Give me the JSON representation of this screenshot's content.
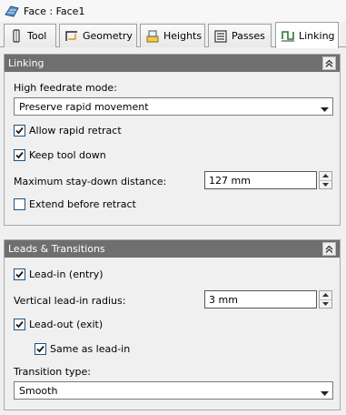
{
  "window": {
    "title": "Face : Face1"
  },
  "tabs": [
    {
      "label": "Tool",
      "icon": "tool-icon"
    },
    {
      "label": "Geometry",
      "icon": "geometry-icon"
    },
    {
      "label": "Heights",
      "icon": "heights-icon"
    },
    {
      "label": "Passes",
      "icon": "passes-icon"
    },
    {
      "label": "Linking",
      "icon": "linking-icon",
      "active": true
    }
  ],
  "linking": {
    "header": "Linking",
    "high_feedrate_label": "High feedrate mode:",
    "high_feedrate_value": "Preserve rapid movement",
    "allow_rapid_retract": {
      "label": "Allow rapid retract",
      "checked": true
    },
    "keep_tool_down": {
      "label": "Keep tool down",
      "checked": true
    },
    "max_stay_down_label": "Maximum stay-down distance:",
    "max_stay_down_value": "127 mm",
    "extend_before_retract": {
      "label": "Extend before retract",
      "checked": false
    }
  },
  "leads": {
    "header": "Leads & Transitions",
    "lead_in": {
      "label": "Lead-in (entry)",
      "checked": true
    },
    "vertical_radius_label": "Vertical lead-in radius:",
    "vertical_radius_value": "3 mm",
    "lead_out": {
      "label": "Lead-out (exit)",
      "checked": true
    },
    "same_as_lead_in": {
      "label": "Same as lead-in",
      "checked": true
    },
    "transition_label": "Transition type:",
    "transition_value": "Smooth"
  },
  "colors": {
    "section_header_bg": "#6f6f6f",
    "panel_bg": "#f0f0f0",
    "checkbox_border": "#1c5180"
  }
}
